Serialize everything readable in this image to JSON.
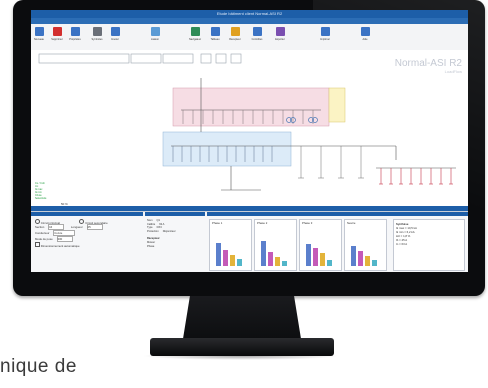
{
  "window": {
    "title": "Etude bâtiment client Normal-ASI R2"
  },
  "ribbon": {
    "tabs": [
      "Accueil",
      "Calculs",
      "Affichage",
      "Synthèse",
      "Réseau"
    ],
    "buttons": [
      "Nouveau",
      "Supprimer",
      "Propriétés",
      "Symboles",
      "Insérer",
      "Liaison",
      "Navigateur",
      "Tableau",
      "Récepteur",
      "Contrôles",
      "Exporter",
      "Imprimer",
      "Aide"
    ]
  },
  "drawing": {
    "watermark_title": "Normal-ASI R2",
    "watermark_sub": "LoadFlow",
    "legend_lines": [
      "Cs / Coh",
      "Icc",
      "Ik max",
      "Ik min",
      "Chute",
      "Sélectivité"
    ],
    "zoom": "50 %"
  },
  "bottom_panel": {
    "left": {
      "radio_1": "Circuit principal",
      "radio_2": "Circuit secondaire",
      "field_1_label": "Section",
      "field_1_value": "16",
      "field_2_label": "Longueur",
      "field_2_value": "25",
      "field_3_label": "Conducteur",
      "field_3_value": "Cuivre",
      "field_4_label": "Mode de pose",
      "field_4_value": "300",
      "checkbox": "Dimensionnement automatique"
    },
    "mid": {
      "labels": [
        "Nom",
        "Calibre",
        "Type",
        "Protection"
      ],
      "values": [
        "Q1",
        "63 A",
        "DX3",
        "Disjoncteur"
      ],
      "section_label": "Récepteur",
      "section_values": [
        "Moteur",
        "Phase"
      ]
    },
    "charts": [
      {
        "title": "Phase 1",
        "values": [
          0.65,
          0.45,
          0.3,
          0.2
        ]
      },
      {
        "title": "Phase 2",
        "values": [
          0.7,
          0.4,
          0.25,
          0.15
        ]
      },
      {
        "title": "Phase 3",
        "values": [
          0.6,
          0.5,
          0.35,
          0.18
        ]
      },
      {
        "title": "Neutre",
        "values": [
          0.55,
          0.42,
          0.28,
          0.16
        ]
      }
    ],
    "summary": {
      "title": "Synthèse",
      "lines": [
        "Ik max = 10,5 kA",
        "Ik min = 6,2 kA",
        "ΔU = 1,8 %",
        "Ib = 45 A",
        "In = 63 A"
      ]
    }
  },
  "caption": "nique de"
}
